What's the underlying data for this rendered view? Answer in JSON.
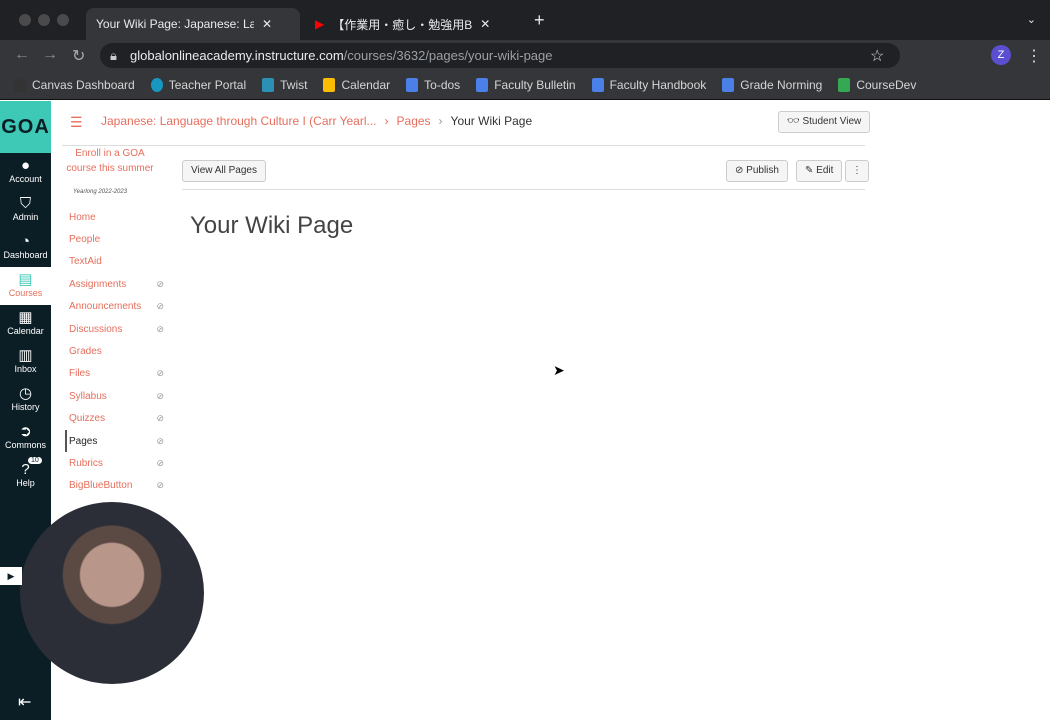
{
  "browser": {
    "tabs": [
      {
        "title": "Your Wiki Page: Japanese: Lan"
      },
      {
        "title": "【作業用・癒し・勉強用BGM】ジ"
      }
    ],
    "url_host": "globalonlineacademy.instructure.com",
    "url_path": "/courses/3632/pages/your-wiki-page",
    "profile_initial": "Z",
    "bookmarks": [
      "Canvas Dashboard",
      "Teacher Portal",
      "Twist",
      "Calendar",
      "To-dos",
      "Faculty Bulletin",
      "Faculty Handbook",
      "Grade Norming",
      "CourseDev"
    ]
  },
  "global_nav": {
    "logo": "GOA",
    "items": [
      "Account",
      "Admin",
      "Dashboard",
      "Courses",
      "Calendar",
      "Inbox",
      "History",
      "Commons",
      "Help"
    ],
    "help_badge": "10"
  },
  "breadcrumb": [
    "Japanese: Language through Culture I (Carr Yearl...",
    "Pages",
    "Your Wiki Page"
  ],
  "student_view": "Student View",
  "course_nav": {
    "enroll": "Enroll in a GOA course this summer",
    "term": "Yearlong 2022-2023",
    "items": [
      "Home",
      "People",
      "TextAid",
      "Assignments",
      "Announcements",
      "Discussions",
      "Grades",
      "Files",
      "Syllabus",
      "Quizzes",
      "Pages",
      "Rubrics",
      "BigBlueButton"
    ]
  },
  "toolbar": {
    "view_all": "View All Pages",
    "publish": "Publish",
    "edit": "Edit"
  },
  "page_title": "Your Wiki Page"
}
